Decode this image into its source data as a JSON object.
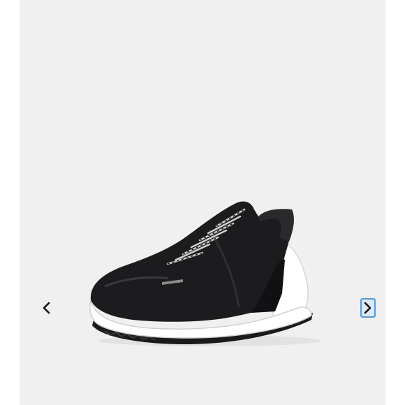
{
  "gallery": {
    "image": {
      "subject": "shoe-image",
      "colors": {
        "background": "#f0f0f0",
        "upper": "#1c1c1e",
        "sole": "#ffffff",
        "outsole": "#1a1a1a",
        "focus_ring": "#5b9bd5"
      }
    },
    "prev_icon": "chevron-left-icon",
    "next_icon": "chevron-right-icon",
    "next_focused": true
  }
}
